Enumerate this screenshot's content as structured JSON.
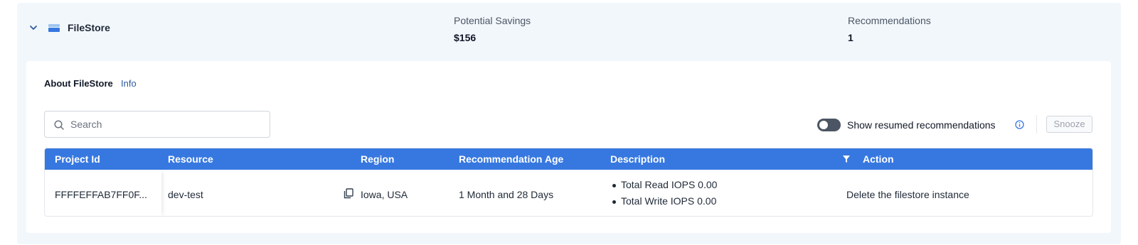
{
  "section": {
    "title": "FileStore",
    "potential_savings_label": "Potential Savings",
    "potential_savings_value": "$156",
    "recommendations_label": "Recommendations",
    "recommendations_value": "1"
  },
  "about": {
    "title": "About FileStore",
    "info_link": "Info"
  },
  "search": {
    "placeholder": "Search",
    "value": ""
  },
  "toolbar": {
    "toggle_label": "Show resumed recommendations",
    "toggle_on": false,
    "snooze_label": "Snooze"
  },
  "table": {
    "columns": [
      "Project Id",
      "Resource",
      "Region",
      "Recommendation Age",
      "Description",
      "Action"
    ],
    "rows": [
      {
        "project_id": "FFFFEFFAB7FF0F...",
        "resource": "dev-test",
        "region": "Iowa, USA",
        "age": "1 Month and 28 Days",
        "description": [
          "Total Read IOPS 0.00",
          "Total Write IOPS 0.00"
        ],
        "action": "Delete the filestore instance"
      }
    ]
  },
  "colors": {
    "header_bg": "#3778e0",
    "panel_bg": "#f2f7fc",
    "link": "#2c5aa0"
  }
}
